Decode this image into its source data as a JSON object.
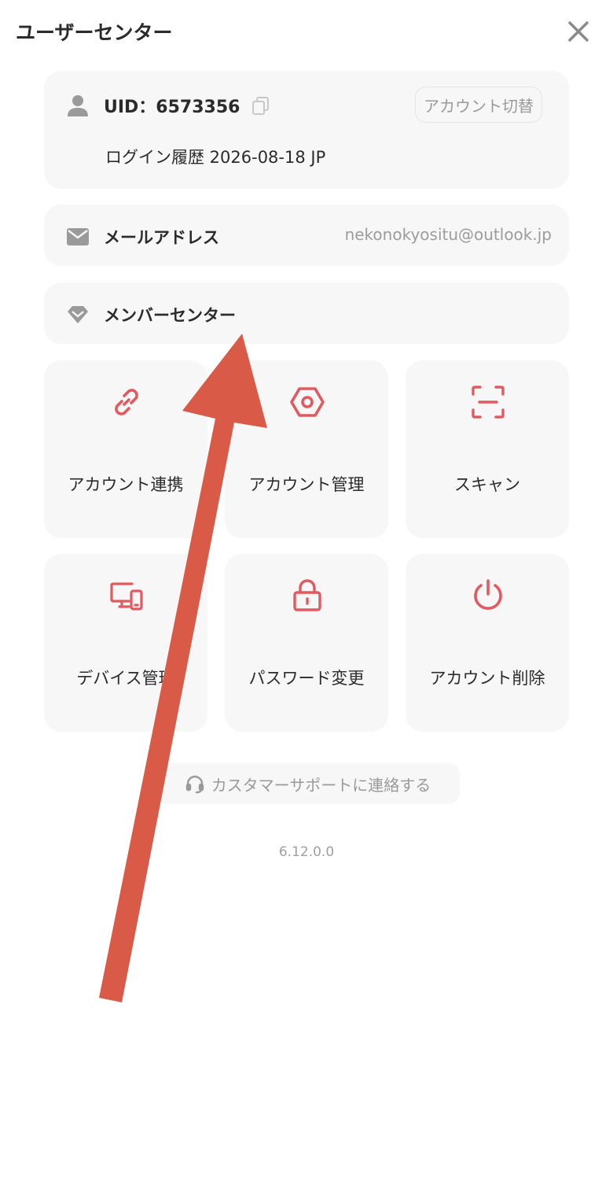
{
  "header": {
    "title": "ユーザーセンター",
    "close_icon": "close-icon"
  },
  "account": {
    "uid": "UID：6573356",
    "switch_label": "アカウント切替",
    "login_history": "ログイン履歴 2026-08-18 JP"
  },
  "email": {
    "label": "メールアドレス",
    "value": "nekonokyositu@outlook.jp"
  },
  "member": {
    "label": "メンバーセンター"
  },
  "tiles": [
    {
      "label": "アカウント連携",
      "icon": "link-icon"
    },
    {
      "label": "アカウント管理",
      "icon": "hexagon-settings-icon"
    },
    {
      "label": "スキャン",
      "icon": "scan-icon"
    },
    {
      "label": "デバイス管理",
      "icon": "devices-icon"
    },
    {
      "label": "パスワード変更",
      "icon": "lock-icon"
    },
    {
      "label": "アカウント削除",
      "icon": "power-icon"
    }
  ],
  "support": {
    "label": "カスタマーサポートに連絡する"
  },
  "version": "6.12.0.0",
  "colors": {
    "accent": "#e05a5f",
    "arrow": "#d95a47",
    "card_bg": "#f7f7f7",
    "icon_gray": "#9a9a9a"
  }
}
